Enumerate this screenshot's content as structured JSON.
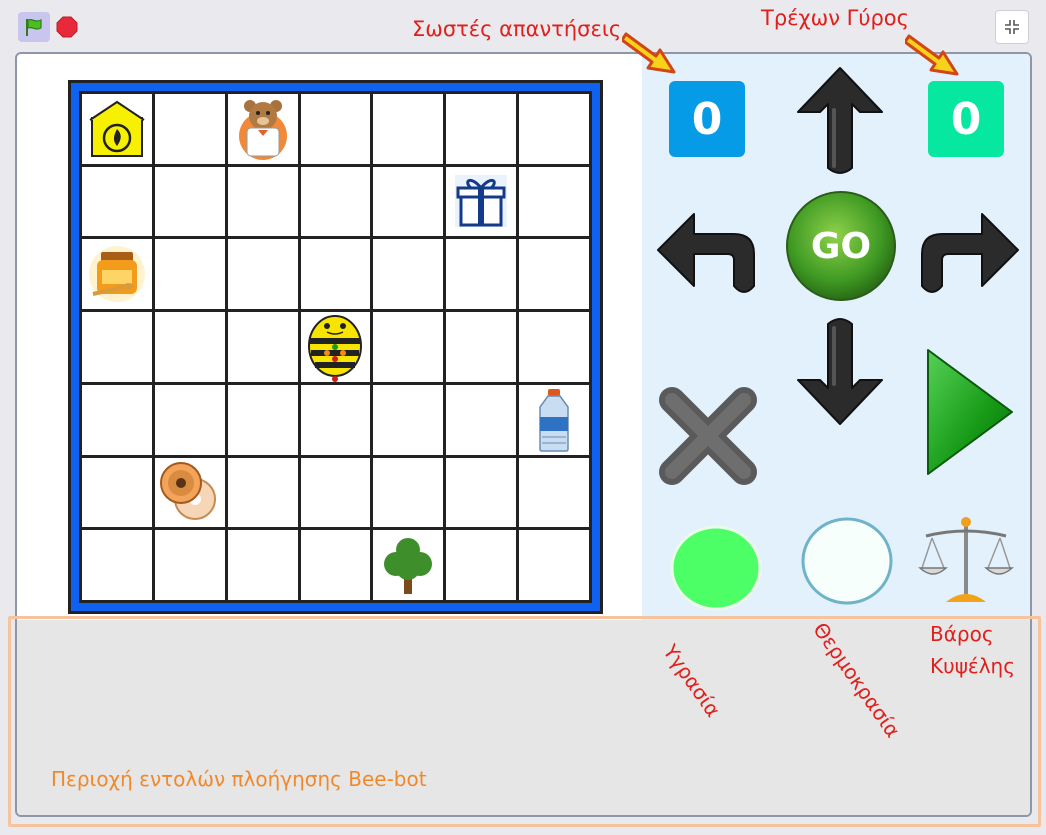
{
  "toolbar": {
    "green_flag_icon": "green-flag-icon",
    "stop_icon": "stop-icon",
    "fullscreen_icon": "exit-fullscreen-icon"
  },
  "labels": {
    "correct_answers": "Σωστές απαντήσεις",
    "current_round": "Τρέχων Γύρος",
    "humidity": "Υγρασία",
    "temperature": "Θερμοκρασία",
    "hive_weight_line1": "Βάρος",
    "hive_weight_line2": "Κυψέλης",
    "nav_area": "Περιοχή εντολών πλοήγησης Bee-bot"
  },
  "counters": {
    "correct_answers_value": "0",
    "current_round_value": "0"
  },
  "controls": {
    "go_label": "GO"
  },
  "grid": {
    "rows": 7,
    "cols": 7,
    "items": [
      {
        "row": 0,
        "col": 0,
        "icon": "fire-station-icon"
      },
      {
        "row": 0,
        "col": 2,
        "icon": "teddy-doctor-icon"
      },
      {
        "row": 1,
        "col": 5,
        "icon": "gift-icon"
      },
      {
        "row": 2,
        "col": 0,
        "icon": "honey-jar-icon"
      },
      {
        "row": 3,
        "col": 3,
        "icon": "bee-bot-icon"
      },
      {
        "row": 4,
        "col": 6,
        "icon": "water-bottle-icon"
      },
      {
        "row": 5,
        "col": 1,
        "icon": "donuts-icon"
      },
      {
        "row": 6,
        "col": 4,
        "icon": "tree-icon"
      }
    ]
  },
  "colors": {
    "grid_border": "#0f62ef",
    "counter_correct": "#069be7",
    "counter_round": "#06e8a0",
    "label_red": "#e0201c",
    "nav_label": "#f0892b",
    "panel_bg": "#e3f1fd",
    "humidity_fill": "#4cff66"
  }
}
